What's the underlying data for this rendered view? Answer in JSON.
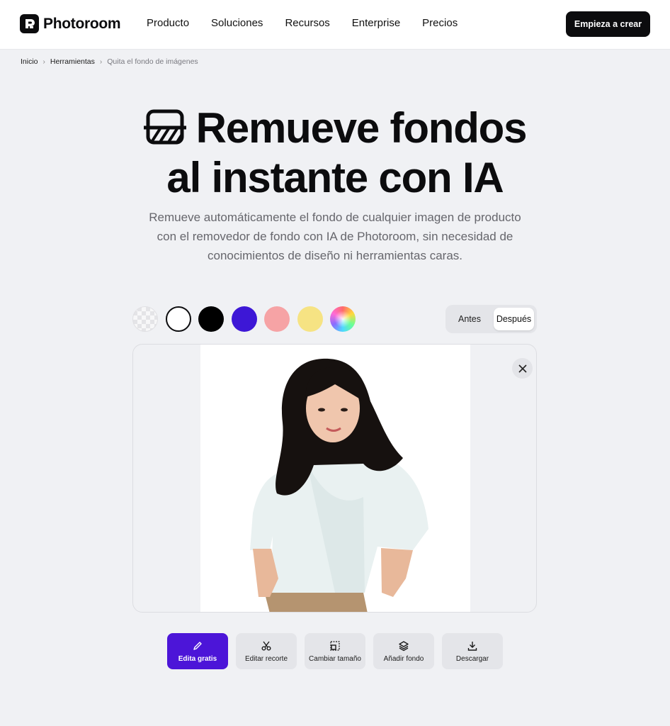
{
  "header": {
    "logo_text": "Photoroom",
    "nav": [
      {
        "label": "Producto"
      },
      {
        "label": "Soluciones"
      },
      {
        "label": "Recursos"
      },
      {
        "label": "Enterprise"
      },
      {
        "label": "Precios"
      }
    ],
    "cta_label": "Empieza a crear"
  },
  "breadcrumb": {
    "items": [
      "Inicio",
      "Herramientas"
    ],
    "current": "Quita el fondo de imágenes"
  },
  "hero": {
    "title_line1": "Remueve fondos",
    "title_line2": "al instante con IA",
    "subtitle": "Remueve automáticamente el fondo de cualquier imagen de producto con el removedor de fondo con IA de Photoroom, sin necesidad de conocimientos de diseño ni herramientas caras."
  },
  "swatches": [
    {
      "name": "transparent",
      "color": "transparent"
    },
    {
      "name": "white",
      "color": "#ffffff"
    },
    {
      "name": "black",
      "color": "#000000"
    },
    {
      "name": "purple",
      "color": "#3d17d6"
    },
    {
      "name": "pink",
      "color": "#f6a3a5"
    },
    {
      "name": "yellow",
      "color": "#f6e383"
    },
    {
      "name": "custom-color",
      "color": "gradient"
    }
  ],
  "toggle": {
    "before_label": "Antes",
    "after_label": "Después",
    "selected": "Después"
  },
  "toolbar": [
    {
      "label": "Edita gratis",
      "icon": "pencil-icon",
      "primary": true
    },
    {
      "label": "Editar recorte",
      "icon": "scissors-icon"
    },
    {
      "label": "Cambiar tamaño",
      "icon": "resize-icon"
    },
    {
      "label": "Añadir fondo",
      "icon": "layers-icon"
    },
    {
      "label": "Descargar",
      "icon": "download-icon"
    }
  ],
  "colors": {
    "accent": "#4c15d8",
    "dark": "#0c0c0e",
    "page_bg": "#f0f1f4"
  }
}
